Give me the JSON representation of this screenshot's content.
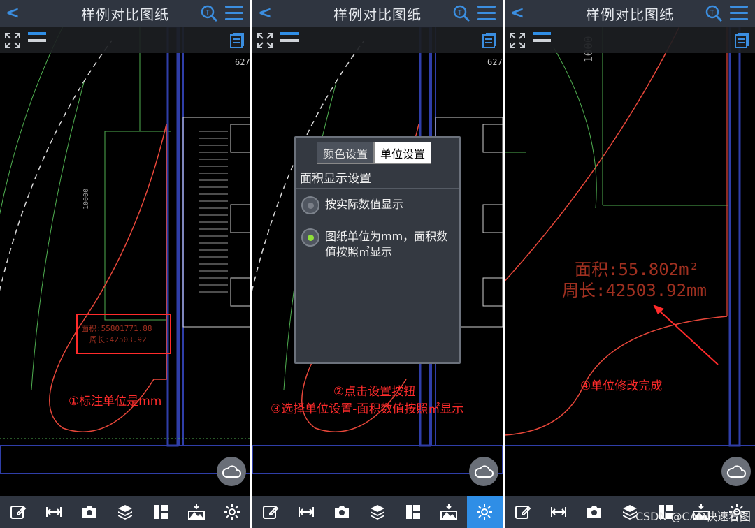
{
  "app": {
    "title": "样例对比图纸"
  },
  "panel1": {
    "cad_area_text": "面积:55801771.88",
    "cad_perimeter_text": "周长:42503.92",
    "cad_dim_text": "10000",
    "cad_side_text": "627",
    "annotation": "①标注单位是mm"
  },
  "panel2": {
    "cad_side_text": "627",
    "dialog": {
      "tab_color": "颜色设置",
      "tab_unit": "单位设置",
      "heading": "面积显示设置",
      "option1": "按实际数值显示",
      "option2_line1": "图纸单位为mm，面积数",
      "option2_line2": "值按照㎡显示",
      "selected_option": 2
    },
    "annotation_line1": "②点击设置按钮",
    "annotation_line2": "③选择单位设置-面积数值按照㎡显示"
  },
  "panel3": {
    "cad_area_text": "面积:55.802m²",
    "cad_perimeter_text": "周长:42503.92mm",
    "cad_dim_text": "1000",
    "annotation": "④单位修改完成"
  },
  "toolbar": {
    "tools": [
      "edit-icon",
      "measure-icon",
      "camera-icon",
      "layers-icon",
      "layout-icon",
      "image-icon",
      "gear-icon"
    ],
    "active_in_panel2": "gear-icon"
  },
  "watermark": "CSDN @CAD快速看图",
  "colors": {
    "accent": "#2f8ee6",
    "annotation": "#ff2b2b",
    "topbar": "#2f3540"
  }
}
